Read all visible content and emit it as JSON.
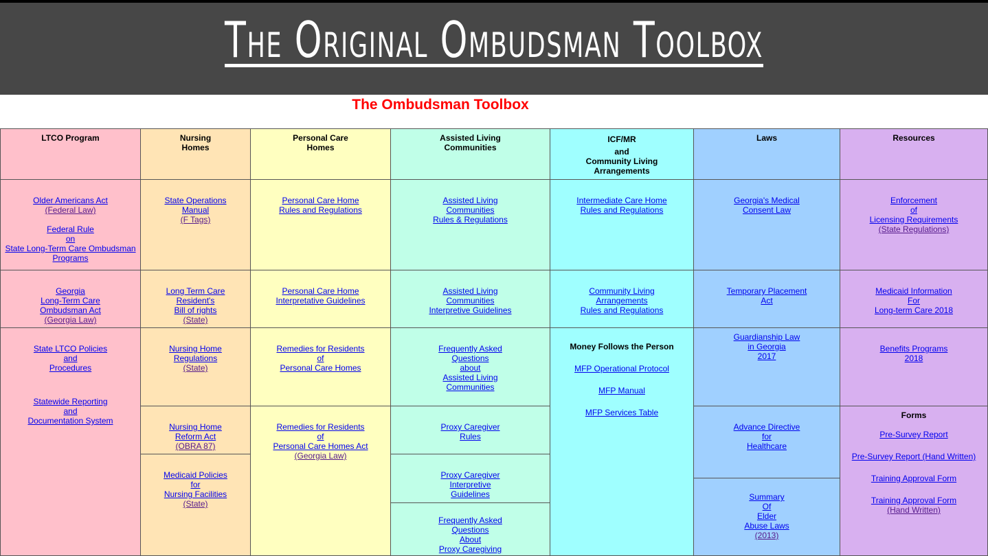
{
  "banner": {
    "title": "The Original Ombudsman Toolbox"
  },
  "page_title": "The Ombudsman Toolbox",
  "columns": {
    "ltco": {
      "header": [
        "LTCO Program"
      ],
      "r1": [
        [
          "Older Americans Act",
          "(Federal Law)"
        ],
        [
          "Federal Rule",
          "on",
          "State Long-Term Care Ombudsman",
          "Programs"
        ]
      ],
      "r2": [
        [
          "Georgia",
          "Long-Term Care",
          "Ombudsman Act",
          "(Georgia Law)"
        ]
      ],
      "r3": [
        [
          "State LTCO Policies",
          "and",
          "Procedures"
        ],
        [
          "Statewide Reporting",
          "and",
          "Documentation System"
        ]
      ]
    },
    "nursing": {
      "header": [
        "Nursing",
        "Homes"
      ],
      "r1": [
        [
          "State Operations",
          "Manual",
          "(F Tags)"
        ]
      ],
      "r2": [
        [
          "Long Term Care",
          "Resident's",
          "Bill of rights",
          "(State)"
        ]
      ],
      "r3": [
        [
          "Nursing Home",
          "Regulations",
          "(State)"
        ]
      ],
      "r4": [
        [
          "Nursing Home",
          "Reform Act",
          "(OBRA 87)"
        ]
      ],
      "r5": [
        [
          "Medicaid Policies",
          "for",
          "Nursing Facilities",
          "(State)"
        ]
      ]
    },
    "personal": {
      "header": [
        "Personal Care",
        "Homes"
      ],
      "r1": [
        [
          "Personal Care Home",
          "Rules and Regulations"
        ]
      ],
      "r2": [
        [
          "Personal Care Home",
          "Interpretative Guidelines"
        ]
      ],
      "r3": [
        [
          "Remedies for Residents",
          "of",
          "Personal Care Homes"
        ]
      ],
      "r4": [
        [
          "Remedies for Residents",
          "of",
          "Personal Care Homes Act",
          "(Georgia Law)"
        ]
      ]
    },
    "assisted": {
      "header": [
        "Assisted Living",
        "Communities"
      ],
      "r1": [
        [
          "Assisted Living",
          "Communities",
          "Rules & Regulations"
        ]
      ],
      "r2": [
        [
          "Assisted Living",
          "Communities",
          "Interpretive Guidelines"
        ]
      ],
      "r3": [
        [
          "Frequently Asked",
          "Questions",
          "about",
          "Assisted Living",
          "Communities"
        ]
      ],
      "r4": [
        [
          "Proxy Caregiver",
          "Rules"
        ]
      ],
      "r5": [
        [
          "Proxy Caregiver",
          "Interpretive",
          "Guidelines"
        ]
      ],
      "r6": [
        [
          "Frequently Asked",
          "Questions",
          "About",
          "Proxy Caregiving"
        ]
      ]
    },
    "icf": {
      "header": [
        "ICF/MR",
        "and",
        "Community Living",
        "Arrangements"
      ],
      "r1": [
        [
          "Intermediate Care Home",
          "Rules and Regulations"
        ]
      ],
      "r2": [
        [
          "Community Living",
          "Arrangements",
          "Rules and Regulations"
        ]
      ],
      "r3_heading": "Money Follows the Person",
      "r3": [
        [
          "MFP Operational Protocol"
        ],
        [
          "MFP Manual"
        ],
        [
          "MFP Services Table"
        ]
      ]
    },
    "laws": {
      "header": [
        "Laws"
      ],
      "r1": [
        [
          "Georgia's Medical",
          "Consent Law"
        ]
      ],
      "r2": [
        [
          "Temporary Placement",
          "Act"
        ]
      ],
      "r3": [
        [
          "Guardianship Law",
          "in Georgia",
          "2017"
        ]
      ],
      "r4": [
        [
          "Advance Directive",
          "for",
          "Healthcare"
        ]
      ],
      "r5": [
        [
          "Summary",
          "Of",
          "Elder",
          "Abuse Laws",
          "(2013)"
        ]
      ]
    },
    "resources": {
      "header": [
        "Resources"
      ],
      "r1": [
        [
          "Enforcement",
          "of",
          "Licensing Requirements",
          "(State Regulations)"
        ]
      ],
      "r2": [
        [
          "Medicaid Information",
          "For",
          "Long-term Care 2018"
        ]
      ],
      "r3": [
        [
          "Benefits Programs",
          "2018"
        ]
      ],
      "forms_heading": "Forms",
      "r4": [
        [
          "Pre-Survey Report"
        ],
        [
          "Pre-Survey Report (Hand Written)"
        ],
        [
          "Training Approval Form"
        ],
        [
          "Training Approval Form",
          "(Hand Written)"
        ]
      ]
    }
  }
}
